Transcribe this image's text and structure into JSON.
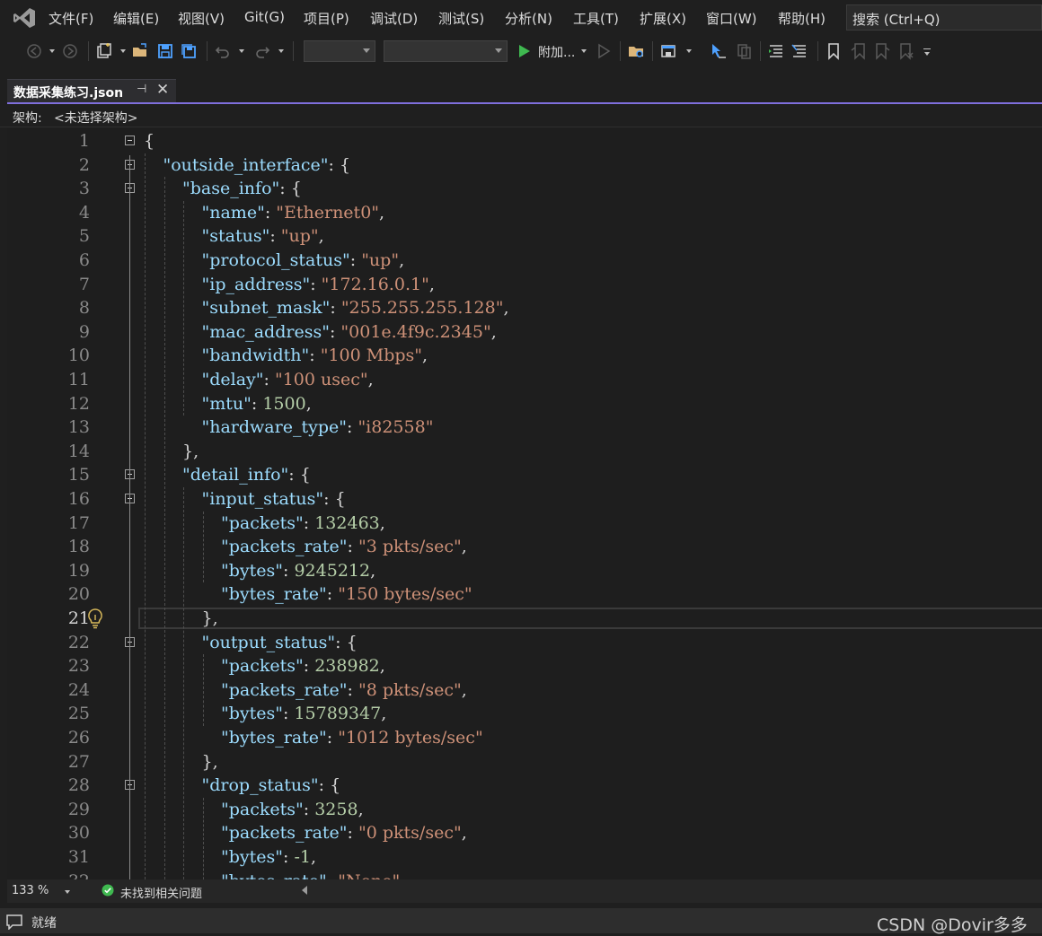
{
  "menu": {
    "items": [
      "文件(F)",
      "编辑(E)",
      "视图(V)",
      "Git(G)",
      "项目(P)",
      "调试(D)",
      "测试(S)",
      "分析(N)",
      "工具(T)",
      "扩展(X)",
      "窗口(W)",
      "帮助(H)"
    ]
  },
  "search": {
    "placeholder": "搜索 (Ctrl+Q)"
  },
  "toolbar": {
    "attach_label": "附加..."
  },
  "tab": {
    "title": "数据采集练习.json"
  },
  "schema": {
    "label": "架构:",
    "value": "<未选择架构>"
  },
  "editor": {
    "current_line": 21,
    "lines": [
      [
        [
          "p",
          "{"
        ]
      ],
      [
        [
          "k",
          "\"outside_interface\""
        ],
        [
          "p",
          ": {"
        ]
      ],
      [
        [
          "k",
          "\"base_info\""
        ],
        [
          "p",
          ": {"
        ]
      ],
      [
        [
          "k",
          "\"name\""
        ],
        [
          "p",
          ": "
        ],
        [
          "s",
          "\"Ethernet0\""
        ],
        [
          "p",
          ","
        ]
      ],
      [
        [
          "k",
          "\"status\""
        ],
        [
          "p",
          ": "
        ],
        [
          "s",
          "\"up\""
        ],
        [
          "p",
          ","
        ]
      ],
      [
        [
          "k",
          "\"protocol_status\""
        ],
        [
          "p",
          ": "
        ],
        [
          "s",
          "\"up\""
        ],
        [
          "p",
          ","
        ]
      ],
      [
        [
          "k",
          "\"ip_address\""
        ],
        [
          "p",
          ": "
        ],
        [
          "s",
          "\"172.16.0.1\""
        ],
        [
          "p",
          ","
        ]
      ],
      [
        [
          "k",
          "\"subnet_mask\""
        ],
        [
          "p",
          ": "
        ],
        [
          "s",
          "\"255.255.255.128\""
        ],
        [
          "p",
          ","
        ]
      ],
      [
        [
          "k",
          "\"mac_address\""
        ],
        [
          "p",
          ": "
        ],
        [
          "s",
          "\"001e.4f9c.2345\""
        ],
        [
          "p",
          ","
        ]
      ],
      [
        [
          "k",
          "\"bandwidth\""
        ],
        [
          "p",
          ": "
        ],
        [
          "s",
          "\"100 Mbps\""
        ],
        [
          "p",
          ","
        ]
      ],
      [
        [
          "k",
          "\"delay\""
        ],
        [
          "p",
          ": "
        ],
        [
          "s",
          "\"100 usec\""
        ],
        [
          "p",
          ","
        ]
      ],
      [
        [
          "k",
          "\"mtu\""
        ],
        [
          "p",
          ": "
        ],
        [
          "n",
          "1500"
        ],
        [
          "p",
          ","
        ]
      ],
      [
        [
          "k",
          "\"hardware_type\""
        ],
        [
          "p",
          ": "
        ],
        [
          "s",
          "\"i82558\""
        ]
      ],
      [
        [
          "p",
          "},"
        ]
      ],
      [
        [
          "k",
          "\"detail_info\""
        ],
        [
          "p",
          ": {"
        ]
      ],
      [
        [
          "k",
          "\"input_status\""
        ],
        [
          "p",
          ": {"
        ]
      ],
      [
        [
          "k",
          "\"packets\""
        ],
        [
          "p",
          ": "
        ],
        [
          "n",
          "132463"
        ],
        [
          "p",
          ","
        ]
      ],
      [
        [
          "k",
          "\"packets_rate\""
        ],
        [
          "p",
          ": "
        ],
        [
          "s",
          "\"3 pkts/sec\""
        ],
        [
          "p",
          ","
        ]
      ],
      [
        [
          "k",
          "\"bytes\""
        ],
        [
          "p",
          ": "
        ],
        [
          "n",
          "9245212"
        ],
        [
          "p",
          ","
        ]
      ],
      [
        [
          "k",
          "\"bytes_rate\""
        ],
        [
          "p",
          ": "
        ],
        [
          "s",
          "\"150 bytes/sec\""
        ]
      ],
      [
        [
          "p",
          "},"
        ]
      ],
      [
        [
          "k",
          "\"output_status\""
        ],
        [
          "p",
          ": {"
        ]
      ],
      [
        [
          "k",
          "\"packets\""
        ],
        [
          "p",
          ": "
        ],
        [
          "n",
          "238982"
        ],
        [
          "p",
          ","
        ]
      ],
      [
        [
          "k",
          "\"packets_rate\""
        ],
        [
          "p",
          ": "
        ],
        [
          "s",
          "\"8 pkts/sec\""
        ],
        [
          "p",
          ","
        ]
      ],
      [
        [
          "k",
          "\"bytes\""
        ],
        [
          "p",
          ": "
        ],
        [
          "n",
          "15789347"
        ],
        [
          "p",
          ","
        ]
      ],
      [
        [
          "k",
          "\"bytes_rate\""
        ],
        [
          "p",
          ": "
        ],
        [
          "s",
          "\"1012 bytes/sec\""
        ]
      ],
      [
        [
          "p",
          "},"
        ]
      ],
      [
        [
          "k",
          "\"drop_status\""
        ],
        [
          "p",
          ": {"
        ]
      ],
      [
        [
          "k",
          "\"packets\""
        ],
        [
          "p",
          ": "
        ],
        [
          "n",
          "3258"
        ],
        [
          "p",
          ","
        ]
      ],
      [
        [
          "k",
          "\"packets_rate\""
        ],
        [
          "p",
          ": "
        ],
        [
          "s",
          "\"0 pkts/sec\""
        ],
        [
          "p",
          ","
        ]
      ],
      [
        [
          "k",
          "\"bytes\""
        ],
        [
          "p",
          ": "
        ],
        [
          "n",
          "-1"
        ],
        [
          "p",
          ","
        ]
      ],
      [
        [
          "k",
          "\"bytes_rate\""
        ],
        [
          "p",
          ": "
        ],
        [
          "s",
          "\"None\""
        ]
      ]
    ]
  },
  "editor_status": {
    "zoom": "133 %",
    "issues": "未找到相关问题"
  },
  "statusbar": {
    "text": "就绪",
    "watermark": "CSDN @Dovir多多"
  },
  "colors": {
    "accent": "#7f6fdc",
    "key": "#9cdcfe",
    "string": "#ce9178",
    "number": "#b5cea8",
    "success": "#3fb950"
  }
}
